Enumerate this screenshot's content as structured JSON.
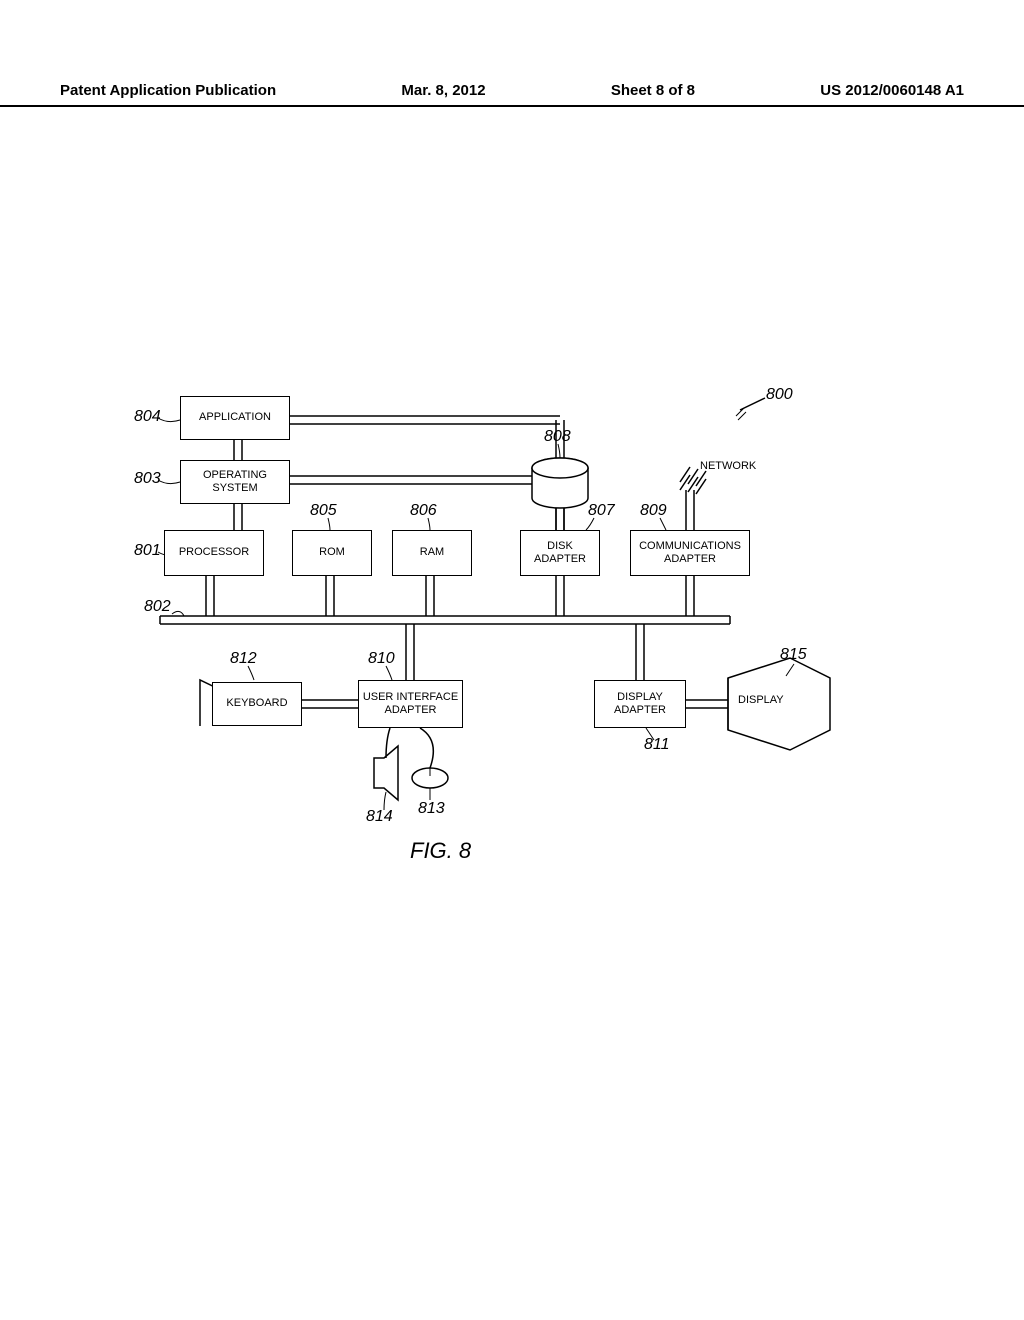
{
  "header": {
    "title": "Patent Application Publication",
    "date": "Mar. 8, 2012",
    "sheet": "Sheet 8 of 8",
    "pub_number": "US 2012/0060148 A1"
  },
  "figure_label": "FIG. 8",
  "blocks": {
    "application": {
      "label": "APPLICATION",
      "ref": "804"
    },
    "operating_system": {
      "label": "OPERATING SYSTEM",
      "ref": "803"
    },
    "processor": {
      "label": "PROCESSOR",
      "ref": "801"
    },
    "rom": {
      "label": "ROM",
      "ref": "805"
    },
    "ram": {
      "label": "RAM",
      "ref": "806"
    },
    "disk_adapter": {
      "label": "DISK ADAPTER",
      "ref": "807"
    },
    "comm_adapter": {
      "label": "COMMUNICATIONS ADAPTER",
      "ref": "809"
    },
    "ui_adapter": {
      "label": "USER INTERFACE ADAPTER",
      "ref": "810"
    },
    "display_adapter": {
      "label": "DISPLAY ADAPTER",
      "ref": "811"
    },
    "keyboard": {
      "label": "KEYBOARD",
      "ref": "812"
    },
    "display": {
      "label": "DISPLAY",
      "ref": "815"
    }
  },
  "refs": {
    "system": "800",
    "bus": "802",
    "disk": "808",
    "mouse": "813",
    "speaker": "814"
  },
  "network_label": "NETWORK"
}
